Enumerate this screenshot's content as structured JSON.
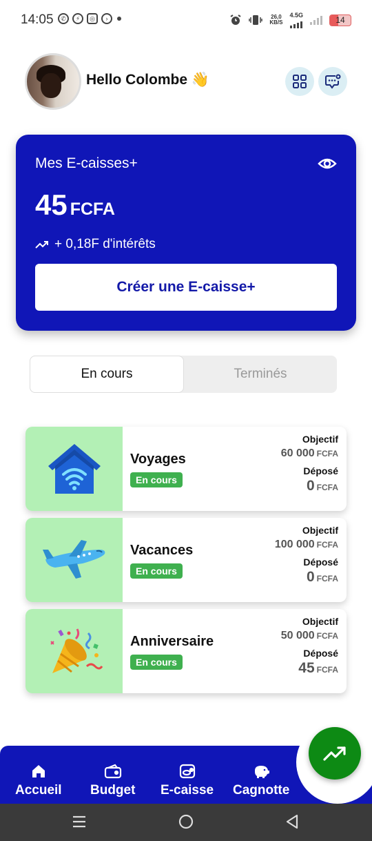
{
  "status_bar": {
    "time": "14:05",
    "net_speed_value": "26,0",
    "net_speed_unit": "KB/S",
    "network": "4.5G",
    "battery": "14",
    "icons": [
      "whatsapp-icon",
      "messenger-icon",
      "instagram-icon",
      "chat-icon",
      "dot-icon",
      "alarm-icon",
      "vibrate-icon",
      "signal-icon",
      "battery-icon"
    ]
  },
  "header": {
    "greeting": "Hello Colombe 👋",
    "icons": [
      "grid-icon",
      "chat-bubble-icon"
    ]
  },
  "balance_card": {
    "title": "Mes E-caisses+",
    "amount": "45",
    "currency": "FCFA",
    "interest": "+ 0,18F d'intérêts",
    "create_button": "Créer une E-caisse+",
    "background_color": "#1016b7"
  },
  "tabs": [
    {
      "label": "En cours",
      "active": true
    },
    {
      "label": "Terminés",
      "active": false
    }
  ],
  "caisses": [
    {
      "name": "Voyages",
      "status": "En cours",
      "objectif_label": "Objectif",
      "objectif_value": "60 000",
      "currency": "FCFA",
      "depose_label": "Déposé",
      "depose_value": "0",
      "icon": "house-wifi-icon"
    },
    {
      "name": "Vacances",
      "status": "En cours",
      "objectif_label": "Objectif",
      "objectif_value": "100 000",
      "currency": "FCFA",
      "depose_label": "Déposé",
      "depose_value": "0",
      "icon": "airplane-icon"
    },
    {
      "name": "Anniversaire",
      "status": "En cours",
      "objectif_label": "Objectif",
      "objectif_value": "50 000",
      "currency": "FCFA",
      "depose_label": "Déposé",
      "depose_value": "45",
      "icon": "party-popper-icon"
    }
  ],
  "bottom_nav": {
    "items": [
      {
        "label": "Accueil",
        "icon": "home-icon"
      },
      {
        "label": "Budget",
        "icon": "wallet-icon"
      },
      {
        "label": "E-caisse",
        "icon": "coins-icon"
      },
      {
        "label": "Cagnotte",
        "icon": "piggy-bank-icon"
      }
    ],
    "fab_icon": "trending-up-icon",
    "color": "#1016b7",
    "fab_color": "#0d8a14"
  }
}
